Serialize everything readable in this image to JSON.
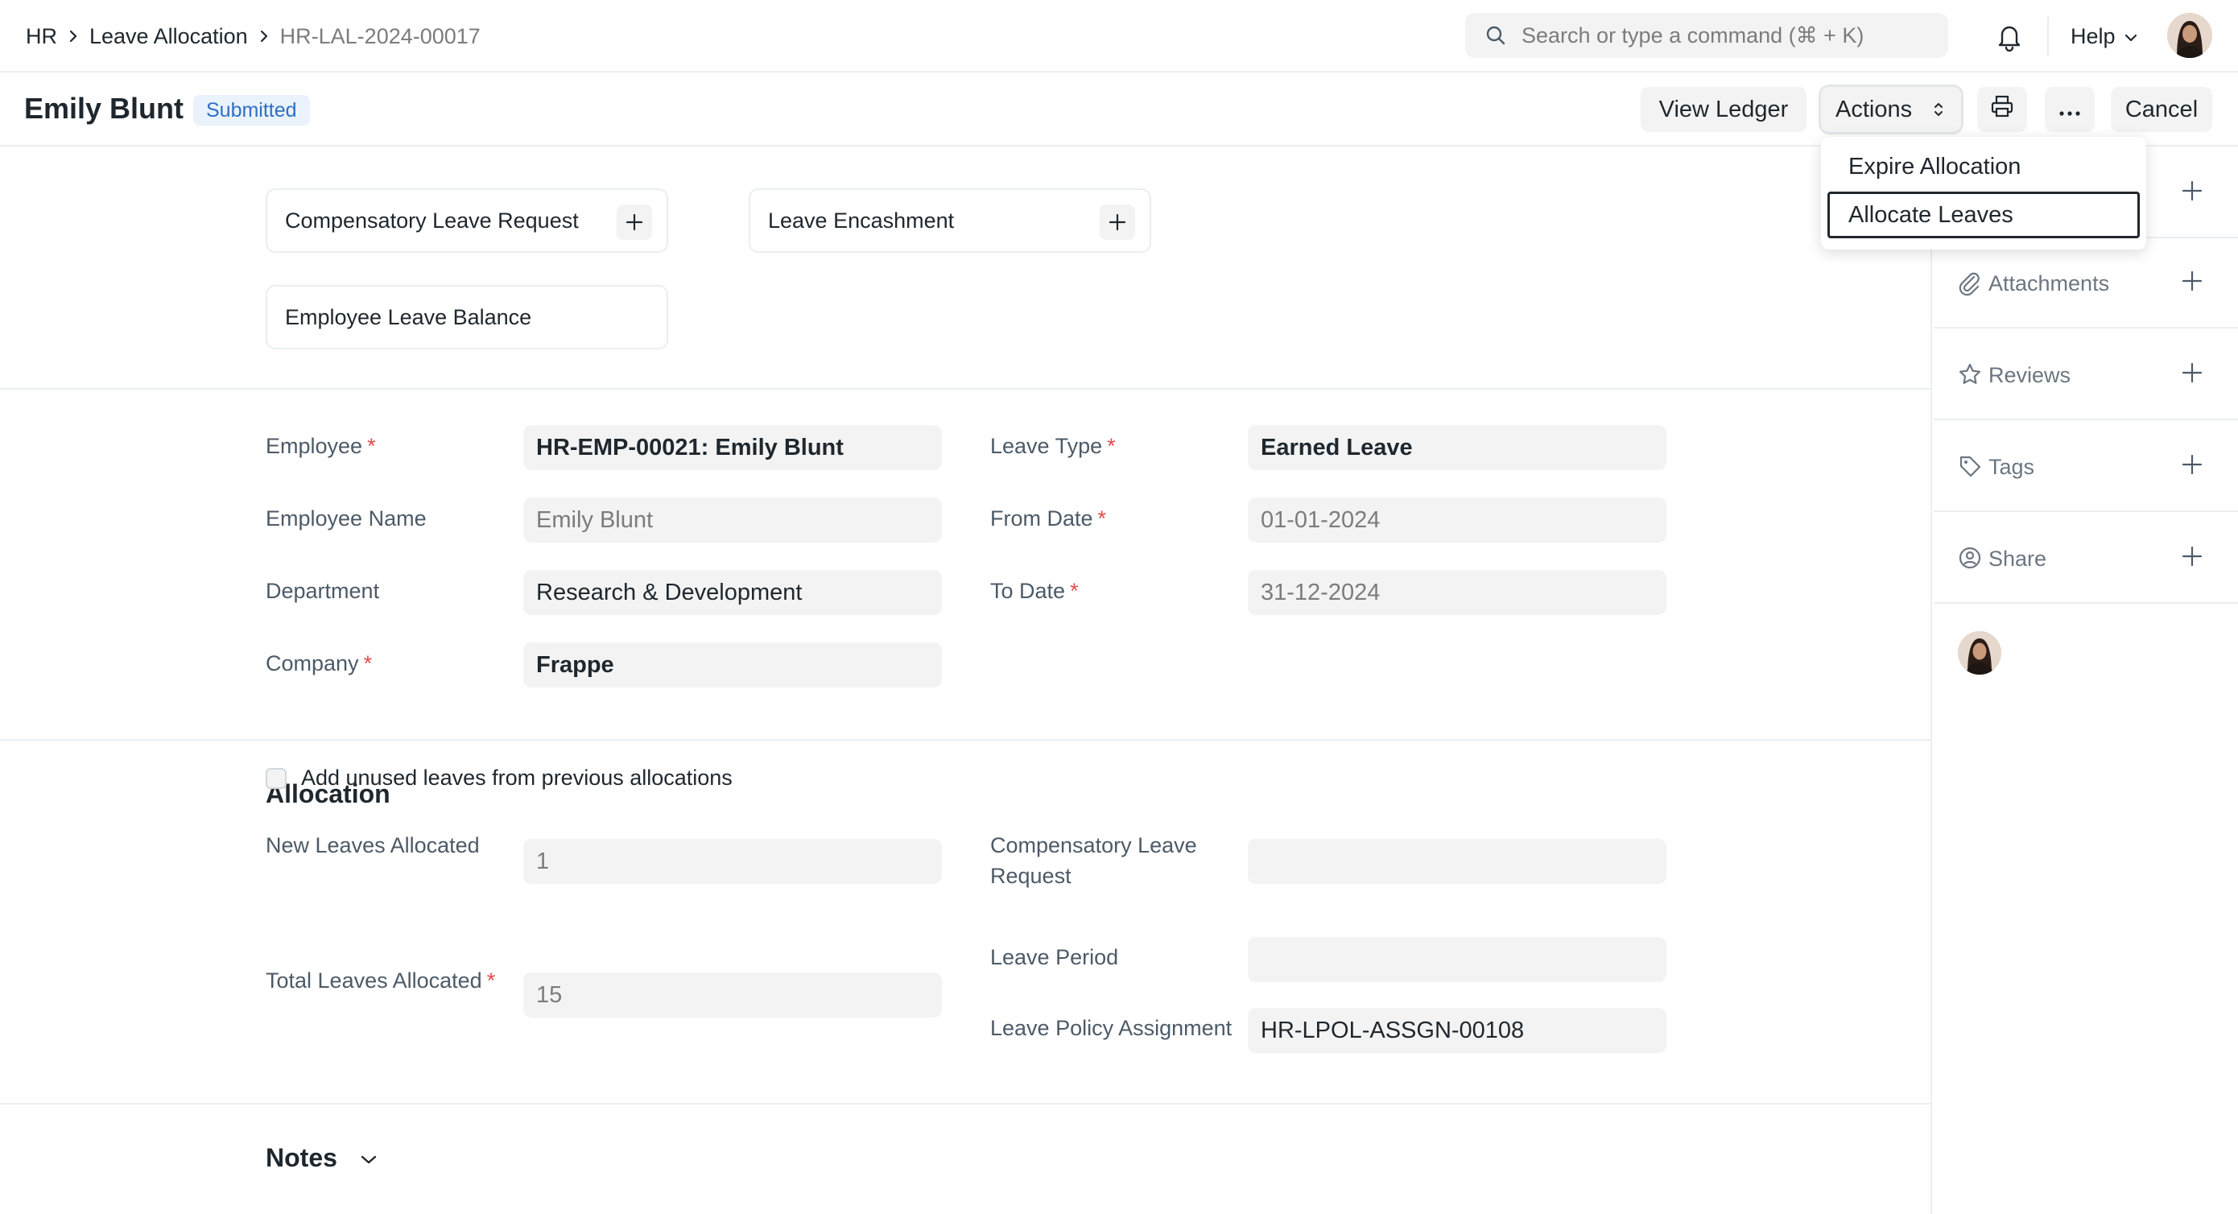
{
  "breadcrumb": [
    "HR",
    "Leave Allocation",
    "HR-LAL-2024-00017"
  ],
  "search": {
    "placeholder": "Search or type a command (⌘ + K)"
  },
  "navbar": {
    "help_label": "Help"
  },
  "header": {
    "title": "Emily Blunt",
    "status": "Submitted",
    "buttons": {
      "view_ledger": "View Ledger",
      "actions": "Actions",
      "cancel": "Cancel"
    }
  },
  "actions_menu": {
    "items": [
      "Expire Allocation",
      "Allocate Leaves"
    ],
    "selected": "Allocate Leaves"
  },
  "connections": {
    "compensatory": "Compensatory Leave Request",
    "encashment": "Leave Encashment",
    "balance": "Employee Leave Balance"
  },
  "details": {
    "employee": {
      "label": "Employee",
      "value": "HR-EMP-00021: Emily Blunt"
    },
    "employee_name": {
      "label": "Employee Name",
      "value": "Emily Blunt"
    },
    "department": {
      "label": "Department",
      "value": "Research & Development"
    },
    "company": {
      "label": "Company",
      "value": "Frappe"
    },
    "leave_type": {
      "label": "Leave Type",
      "value": "Earned Leave"
    },
    "from_date": {
      "label": "From Date",
      "value": "01-01-2024"
    },
    "to_date": {
      "label": "To Date",
      "value": "31-12-2024"
    }
  },
  "allocation": {
    "title": "Allocation",
    "new_leaves": {
      "label": "New Leaves Allocated",
      "value": "1"
    },
    "carry_forward": {
      "label": "Add unused leaves from previous allocations",
      "checked": false
    },
    "total_leaves": {
      "label": "Total Leaves Allocated",
      "value": "15"
    },
    "comp_request": {
      "label_line1": "Compensatory Leave",
      "label_line2": "Request",
      "value": ""
    },
    "leave_period": {
      "label": "Leave Period",
      "value": ""
    },
    "policy_assignment": {
      "label": "Leave Policy Assignment",
      "value": "HR-LPOL-ASSGN-00108"
    }
  },
  "notes": {
    "title": "Notes"
  },
  "sidebar": {
    "attachments": "Attachments",
    "reviews": "Reviews",
    "tags": "Tags",
    "share": "Share"
  },
  "colors": {
    "required": "#e24c4c",
    "status_text": "#2e6fc4",
    "status_bg": "#eaf2fb",
    "field_bg": "#f3f3f3"
  }
}
